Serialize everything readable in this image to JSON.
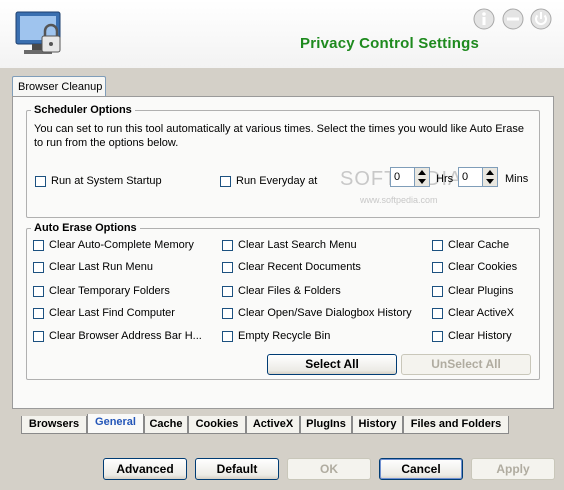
{
  "header": {
    "title": "Privacy Control Settings",
    "icons": [
      "monitor-lock-icon",
      "info-icon",
      "minimize-icon",
      "power-icon"
    ]
  },
  "top_tab": "Browser Cleanup",
  "scheduler": {
    "title": "Scheduler Options",
    "description": "You can set to run this tool automatically at various times. Select the times you would like Auto Erase to run from the options below.",
    "startup_label": "Run at System Startup",
    "everyday_label": "Run Everyday at",
    "hrs_value": "0",
    "hrs_label": "Hrs",
    "mins_value": "0",
    "mins_label": "Mins"
  },
  "watermark": "SOFTPEDIA",
  "watermark_url": "www.softpedia.com",
  "auto_erase": {
    "title": "Auto Erase Options",
    "col1": [
      "Clear Auto-Complete Memory",
      "Clear Last Run Menu",
      "Clear Temporary Folders",
      "Clear Last Find Computer",
      "Clear Browser Address Bar H..."
    ],
    "col2": [
      "Clear Last Search Menu",
      "Clear Recent Documents",
      "Clear Files & Folders",
      "Clear Open/Save Dialogbox History",
      "Empty Recycle Bin"
    ],
    "col3": [
      "Clear Cache",
      "Clear Cookies",
      "Clear Plugins",
      "Clear ActiveX",
      "Clear History"
    ],
    "select_all": "Select All",
    "unselect_all": "UnSelect All"
  },
  "bottom_tabs": [
    "Browsers",
    "General",
    "Cache",
    "Cookies",
    "ActiveX",
    "PlugIns",
    "History",
    "Files and Folders"
  ],
  "buttons": {
    "advanced": "Advanced",
    "default": "Default",
    "ok": "OK",
    "cancel": "Cancel",
    "apply": "Apply"
  }
}
